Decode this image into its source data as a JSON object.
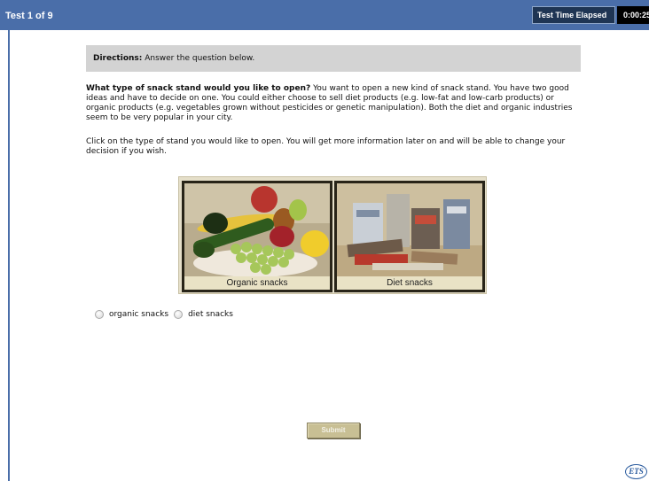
{
  "header": {
    "test_counter": "Test 1 of 9",
    "elapsed_label": "Test Time Elapsed",
    "elapsed_value": "0:00:25"
  },
  "directions": {
    "label": "Directions:",
    "text": " Answer the question below."
  },
  "question": {
    "bold": "What type of snack stand would you like to open?",
    "text": " You want to open a new kind of snack stand. You have two good ideas and have to decide on one. You could either choose to sell diet products (e.g. low-fat and low-carb products) or organic products (e.g. vegetables grown without pesticides or genetic manipulation). Both the diet and organic industries seem to be very popular in your city."
  },
  "instruction": "Click on the type of stand you would like to open. You will get more information later on and will be able to change your decision if you wish.",
  "images": {
    "organic_caption": "Organic snacks",
    "diet_caption": "Diet snacks"
  },
  "options": {
    "organic_label": "organic snacks",
    "diet_label": "diet snacks"
  },
  "submit_label": "Submit",
  "logo_text": "ETS",
  "colors": {
    "header_bar": "#4a6ea9",
    "directions_bg": "#d3d3d3",
    "submit_bg": "#c8bf94"
  }
}
